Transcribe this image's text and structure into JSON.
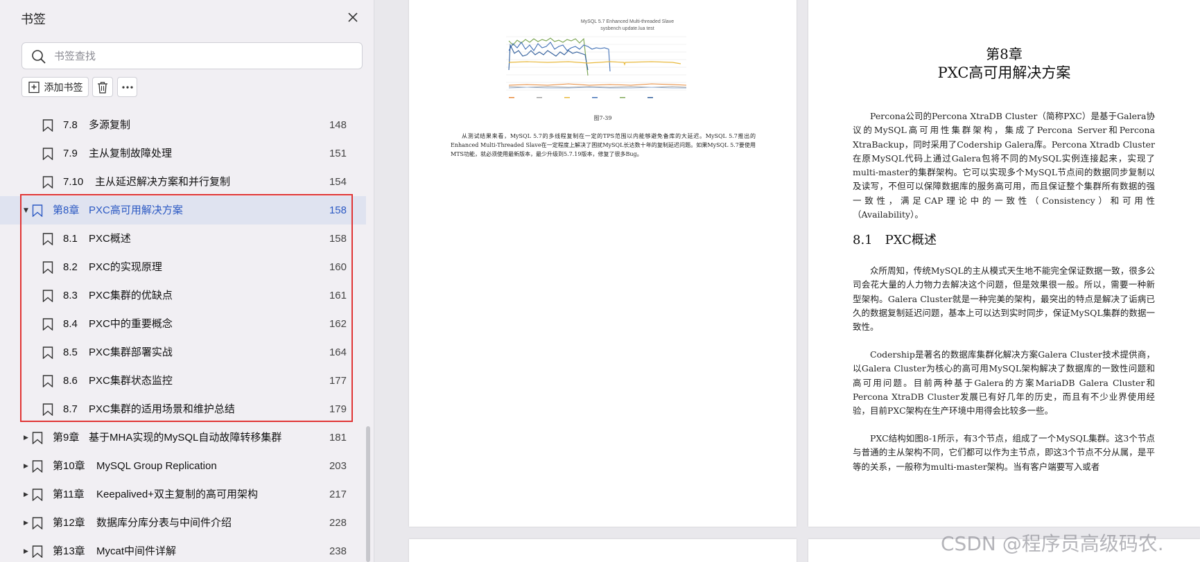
{
  "panel": {
    "title": "书签",
    "search_placeholder": "书签查找",
    "add_label": "添加书签",
    "items": [
      {
        "num": "7.8",
        "text": "多源复制",
        "page": "148",
        "level": 2,
        "active": false,
        "arrow": ""
      },
      {
        "num": "7.9",
        "text": "主从复制故障处理",
        "page": "151",
        "level": 2,
        "active": false,
        "arrow": ""
      },
      {
        "num": "7.10",
        "text": "主从延迟解决方案和并行复制",
        "page": "154",
        "level": 2,
        "active": false,
        "arrow": ""
      },
      {
        "num": "第8章",
        "text": "PXC高可用解决方案",
        "page": "158",
        "level": 1,
        "active": true,
        "arrow": "▼"
      },
      {
        "num": "8.1",
        "text": "PXC概述",
        "page": "158",
        "level": 2,
        "active": false,
        "arrow": ""
      },
      {
        "num": "8.2",
        "text": "PXC的实现原理",
        "page": "160",
        "level": 2,
        "active": false,
        "arrow": ""
      },
      {
        "num": "8.3",
        "text": "PXC集群的优缺点",
        "page": "161",
        "level": 2,
        "active": false,
        "arrow": ""
      },
      {
        "num": "8.4",
        "text": "PXC中的重要概念",
        "page": "162",
        "level": 2,
        "active": false,
        "arrow": ""
      },
      {
        "num": "8.5",
        "text": "PXC集群部署实战",
        "page": "164",
        "level": 2,
        "active": false,
        "arrow": ""
      },
      {
        "num": "8.6",
        "text": "PXC集群状态监控",
        "page": "177",
        "level": 2,
        "active": false,
        "arrow": ""
      },
      {
        "num": "8.7",
        "text": "PXC集群的适用场景和维护总结",
        "page": "179",
        "level": 2,
        "active": false,
        "arrow": ""
      },
      {
        "num": "第9章",
        "text": "基于MHA实现的MySQL自动故障转移集群",
        "page": "181",
        "level": 1,
        "active": false,
        "arrow": "▶"
      },
      {
        "num": "第10章",
        "text": "MySQL Group Replication",
        "page": "203",
        "level": 1,
        "active": false,
        "arrow": "▶"
      },
      {
        "num": "第11章",
        "text": "Keepalived+双主复制的高可用架构",
        "page": "217",
        "level": 1,
        "active": false,
        "arrow": "▶"
      },
      {
        "num": "第12章",
        "text": "数据库分库分表与中间件介绍",
        "page": "228",
        "level": 1,
        "active": false,
        "arrow": "▶"
      },
      {
        "num": "第13章",
        "text": "Mycat中间件详解",
        "page": "238",
        "level": 1,
        "active": false,
        "arrow": "▶"
      }
    ]
  },
  "doc": {
    "page1": {
      "chart_title_1": "MySQL 5.7 Enhanced Multi-threaded Slave",
      "chart_title_2": "sysbench update.lua test",
      "figure_caption": "图7-39",
      "text": "从测试结果来看，MySQL 5.7的多线程复制在一定的TPS范围以内能够避免备库的大延迟。MySQL 5.7推出的Enhanced Multi-Threaded Slave在一定程度上解决了困扰MySQL长达数十年的复制延迟问题。如果MySQL 5.7要使用MTS功能，就必须使用最新版本，最少升级到5.7.19版本，修复了很多Bug。"
    },
    "page2": {
      "chapter": "第8章",
      "chapter_title": "PXC高可用解决方案",
      "para1": "Percona公司的Percona XtraDB Cluster（简称PXC）是基于Galera协议的MySQL高可用性集群架构，集成了Percona Server和Percona XtraBackup，同时采用了Codership Galera库。Percona Xtradb Cluster在原MySQL代码上通过Galera包将不同的MySQL实例连接起来，实现了multi-master的集群架构。它可以实现多个MySQL节点间的数据同步复制以及读写，不但可以保障数据库的服务高可用，而且保证整个集群所有数据的强一致性，满足CAP理论中的一致性（Consistency）和可用性（Availability）。",
      "section": "8.1　PXC概述",
      "para2": "众所周知，传统MySQL的主从模式天生地不能完全保证数据一致，很多公司会花大量的人力物力去解决这个问题，但是效果很一般。所以，需要一种新型架构。Galera Cluster就是一种完美的架构，最突出的特点是解决了诟病已久的数据复制延迟问题，基本上可以达到实时同步，保证MySQL集群的数据一致性。",
      "para3": "Codership是著名的数据库集群化解决方案Galera Cluster技术提供商，以Galera Cluster为核心的高可用MySQL架构解决了数据库的一致性问题和高可用问题。目前两种基于Galera的方案MariaDB Galera Cluster和Percona XtraDB Cluster发展已有好几年的历史，而且有不少业界使用经验，目前PXC架构在生产环境中用得会比较多一些。",
      "para4": "PXC结构如图8-1所示，有3个节点，组成了一个MySQL集群。这3个节点与普通的主从架构不同，它们都可以作为主节点，即这3个节点不分从属，是平等的关系，一般称为multi-master架构。当有客户端要写入或者"
    },
    "watermark": "CSDN @程序员高级码农."
  },
  "colors": {
    "accent": "#2b59c3",
    "highlight_box": "#e03434",
    "active_row": "#dfe3f0"
  }
}
